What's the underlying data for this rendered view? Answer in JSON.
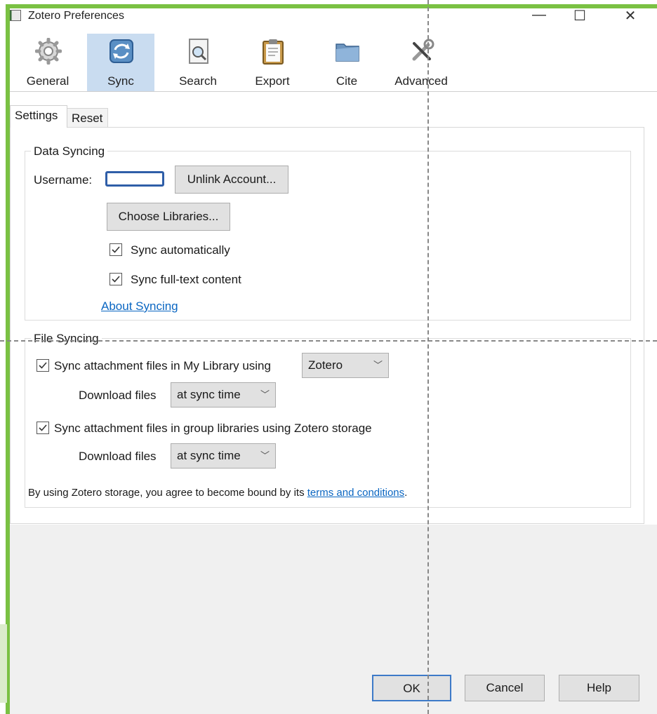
{
  "window": {
    "title": "Zotero Preferences",
    "controls": {
      "minimize": "—",
      "maximize": "☐",
      "close": "✕"
    }
  },
  "toolbar": {
    "items": [
      {
        "label": "General",
        "icon": "gear-icon"
      },
      {
        "label": "Sync",
        "icon": "sync-icon",
        "selected": true
      },
      {
        "label": "Search",
        "icon": "search-icon"
      },
      {
        "label": "Export",
        "icon": "clipboard-icon"
      },
      {
        "label": "Cite",
        "icon": "folder-icon"
      },
      {
        "label": "Advanced",
        "icon": "tools-icon"
      }
    ]
  },
  "tabs": [
    {
      "label": "Settings",
      "selected": true
    },
    {
      "label": "Reset"
    }
  ],
  "data_syncing": {
    "legend": "Data Syncing",
    "username_label": "Username:",
    "unlink_button": "Unlink Account...",
    "choose_libraries_button": "Choose Libraries...",
    "sync_automatically": {
      "label": "Sync automatically",
      "checked": true
    },
    "sync_fulltext": {
      "label": "Sync full-text content",
      "checked": true
    },
    "about_link": "About Syncing"
  },
  "file_syncing": {
    "legend": "File Syncing",
    "my_library": {
      "label": "Sync attachment files in My Library using",
      "checked": true,
      "method": "Zotero"
    },
    "download_label_1": "Download files",
    "download_value_1": "at sync time",
    "group_libraries": {
      "label": "Sync attachment files in group libraries using Zotero storage",
      "checked": true
    },
    "download_label_2": "Download files",
    "download_value_2": "at sync time",
    "terms_prefix": "By using Zotero storage, you agree to become bound by its ",
    "terms_link": "terms and conditions",
    "terms_suffix": "."
  },
  "footer": {
    "ok": "OK",
    "cancel": "Cancel",
    "help": "Help"
  },
  "colors": {
    "accent_green": "#7ac143",
    "selected_toolbar": "#c9dcf0",
    "link": "#0a66c2"
  }
}
